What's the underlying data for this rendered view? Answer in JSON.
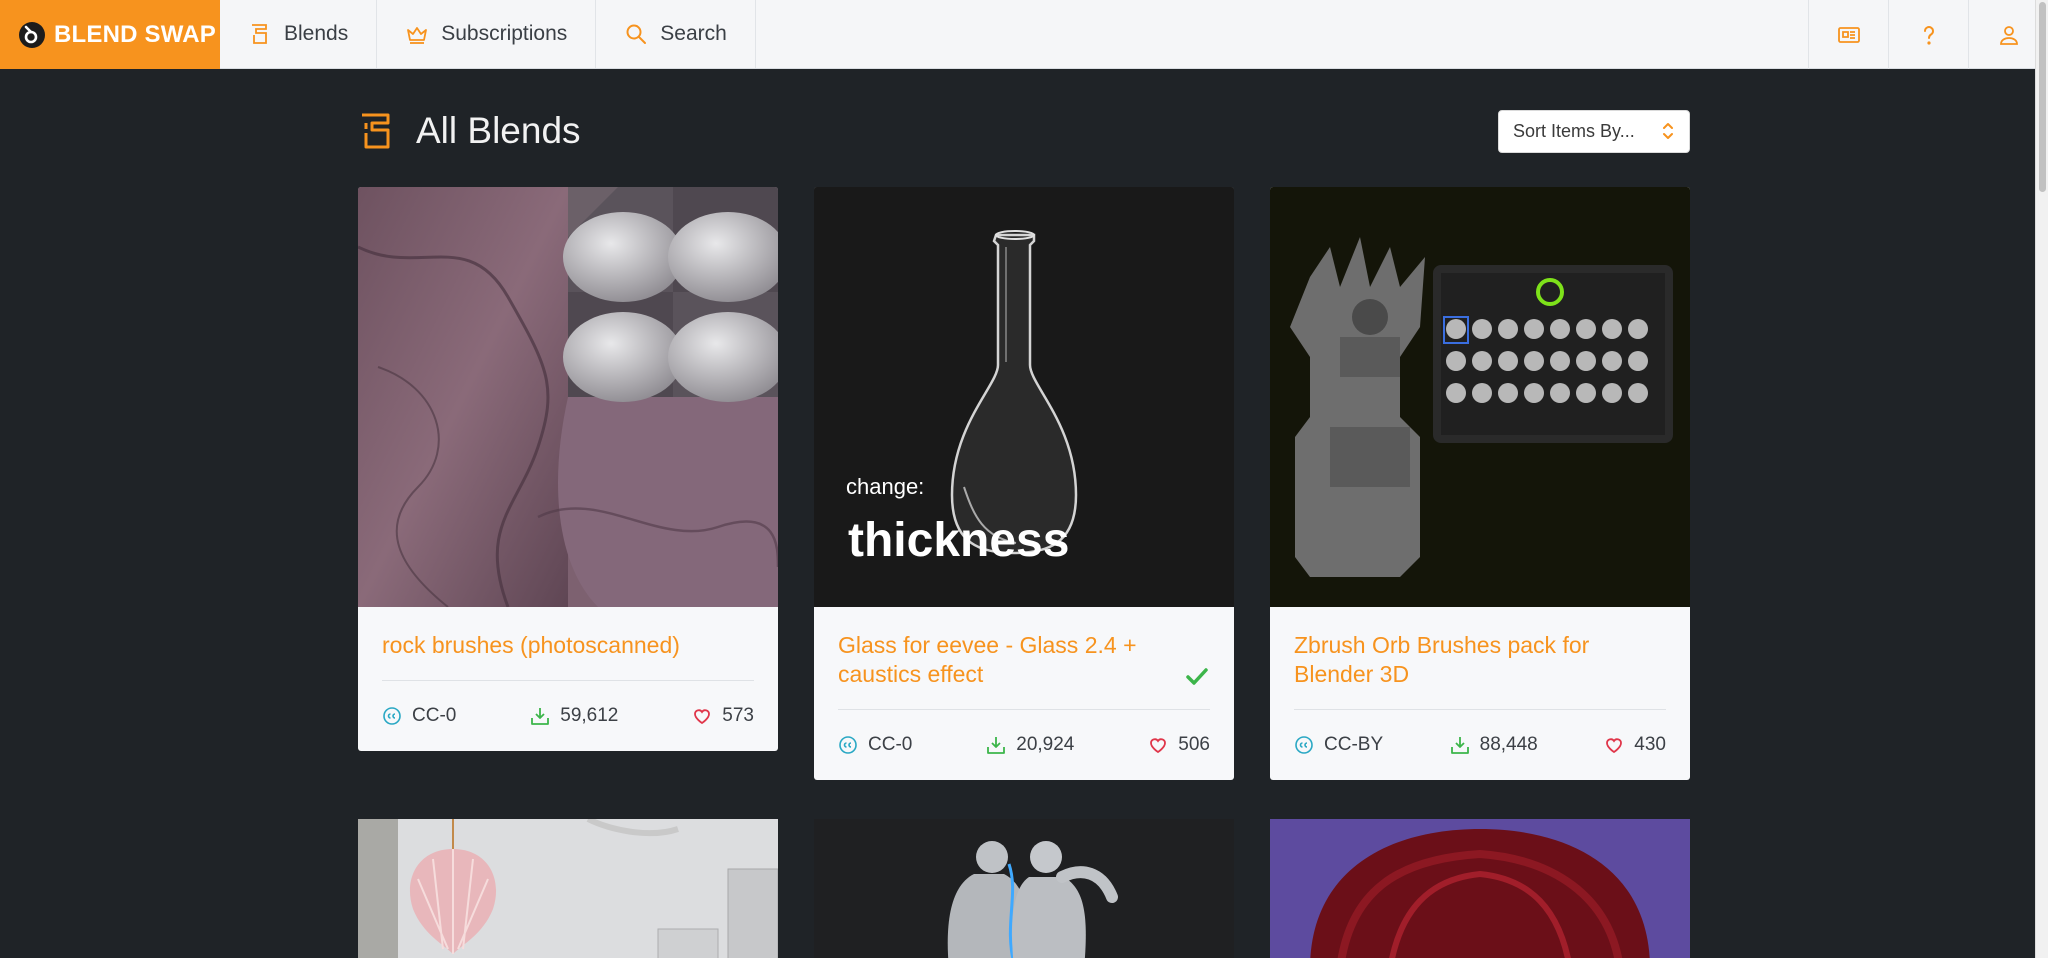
{
  "nav": {
    "brand": "BLEND SWAP",
    "items": [
      {
        "label": "Blends",
        "icon": "blends-icon"
      },
      {
        "label": "Subscriptions",
        "icon": "crown-icon"
      },
      {
        "label": "Search",
        "icon": "search-icon"
      }
    ],
    "right_icons": [
      "news-icon",
      "help-icon",
      "user-icon"
    ]
  },
  "page": {
    "title": "All Blends",
    "sort_placeholder": "Sort Items By..."
  },
  "cards": [
    {
      "title": "rock brushes (photoscanned)",
      "license": "CC-0",
      "downloads": "59,612",
      "likes": "573",
      "verified": false
    },
    {
      "title": "Glass for eevee - Glass 2.4 + caustics effect",
      "license": "CC-0",
      "downloads": "20,924",
      "likes": "506",
      "verified": true
    },
    {
      "title": "Zbrush Orb Brushes pack for Blender 3D",
      "license": "CC-BY",
      "downloads": "88,448",
      "likes": "430",
      "verified": false
    }
  ],
  "thumb_text": {
    "glass_small": "change:",
    "glass_big": "thickness"
  },
  "colors": {
    "accent": "#f7931e",
    "background": "#1f2327",
    "license_icon": "#2aa8c4",
    "download_icon": "#3cb54a",
    "like_icon": "#e0364a"
  }
}
